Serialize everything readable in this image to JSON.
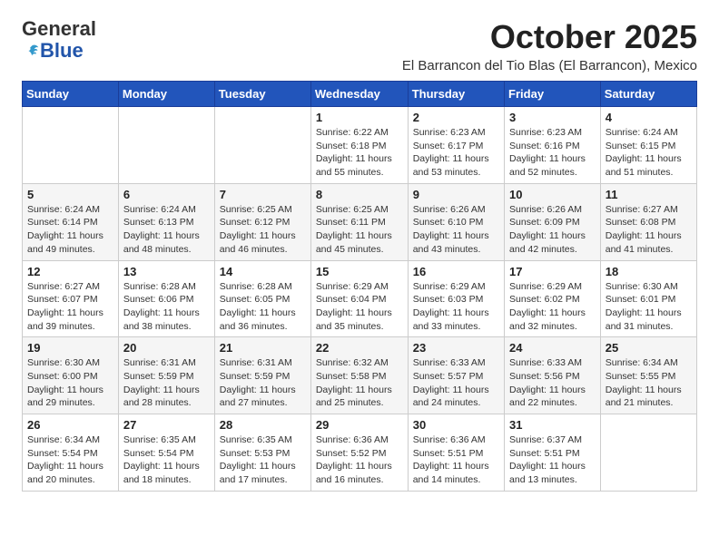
{
  "logo": {
    "general": "General",
    "blue": "Blue"
  },
  "title": "October 2025",
  "subtitle": "El Barrancon del Tio Blas (El Barrancon), Mexico",
  "days_of_week": [
    "Sunday",
    "Monday",
    "Tuesday",
    "Wednesday",
    "Thursday",
    "Friday",
    "Saturday"
  ],
  "weeks": [
    [
      {
        "day": "",
        "info": ""
      },
      {
        "day": "",
        "info": ""
      },
      {
        "day": "",
        "info": ""
      },
      {
        "day": "1",
        "info": "Sunrise: 6:22 AM\nSunset: 6:18 PM\nDaylight: 11 hours\nand 55 minutes."
      },
      {
        "day": "2",
        "info": "Sunrise: 6:23 AM\nSunset: 6:17 PM\nDaylight: 11 hours\nand 53 minutes."
      },
      {
        "day": "3",
        "info": "Sunrise: 6:23 AM\nSunset: 6:16 PM\nDaylight: 11 hours\nand 52 minutes."
      },
      {
        "day": "4",
        "info": "Sunrise: 6:24 AM\nSunset: 6:15 PM\nDaylight: 11 hours\nand 51 minutes."
      }
    ],
    [
      {
        "day": "5",
        "info": "Sunrise: 6:24 AM\nSunset: 6:14 PM\nDaylight: 11 hours\nand 49 minutes."
      },
      {
        "day": "6",
        "info": "Sunrise: 6:24 AM\nSunset: 6:13 PM\nDaylight: 11 hours\nand 48 minutes."
      },
      {
        "day": "7",
        "info": "Sunrise: 6:25 AM\nSunset: 6:12 PM\nDaylight: 11 hours\nand 46 minutes."
      },
      {
        "day": "8",
        "info": "Sunrise: 6:25 AM\nSunset: 6:11 PM\nDaylight: 11 hours\nand 45 minutes."
      },
      {
        "day": "9",
        "info": "Sunrise: 6:26 AM\nSunset: 6:10 PM\nDaylight: 11 hours\nand 43 minutes."
      },
      {
        "day": "10",
        "info": "Sunrise: 6:26 AM\nSunset: 6:09 PM\nDaylight: 11 hours\nand 42 minutes."
      },
      {
        "day": "11",
        "info": "Sunrise: 6:27 AM\nSunset: 6:08 PM\nDaylight: 11 hours\nand 41 minutes."
      }
    ],
    [
      {
        "day": "12",
        "info": "Sunrise: 6:27 AM\nSunset: 6:07 PM\nDaylight: 11 hours\nand 39 minutes."
      },
      {
        "day": "13",
        "info": "Sunrise: 6:28 AM\nSunset: 6:06 PM\nDaylight: 11 hours\nand 38 minutes."
      },
      {
        "day": "14",
        "info": "Sunrise: 6:28 AM\nSunset: 6:05 PM\nDaylight: 11 hours\nand 36 minutes."
      },
      {
        "day": "15",
        "info": "Sunrise: 6:29 AM\nSunset: 6:04 PM\nDaylight: 11 hours\nand 35 minutes."
      },
      {
        "day": "16",
        "info": "Sunrise: 6:29 AM\nSunset: 6:03 PM\nDaylight: 11 hours\nand 33 minutes."
      },
      {
        "day": "17",
        "info": "Sunrise: 6:29 AM\nSunset: 6:02 PM\nDaylight: 11 hours\nand 32 minutes."
      },
      {
        "day": "18",
        "info": "Sunrise: 6:30 AM\nSunset: 6:01 PM\nDaylight: 11 hours\nand 31 minutes."
      }
    ],
    [
      {
        "day": "19",
        "info": "Sunrise: 6:30 AM\nSunset: 6:00 PM\nDaylight: 11 hours\nand 29 minutes."
      },
      {
        "day": "20",
        "info": "Sunrise: 6:31 AM\nSunset: 5:59 PM\nDaylight: 11 hours\nand 28 minutes."
      },
      {
        "day": "21",
        "info": "Sunrise: 6:31 AM\nSunset: 5:59 PM\nDaylight: 11 hours\nand 27 minutes."
      },
      {
        "day": "22",
        "info": "Sunrise: 6:32 AM\nSunset: 5:58 PM\nDaylight: 11 hours\nand 25 minutes."
      },
      {
        "day": "23",
        "info": "Sunrise: 6:33 AM\nSunset: 5:57 PM\nDaylight: 11 hours\nand 24 minutes."
      },
      {
        "day": "24",
        "info": "Sunrise: 6:33 AM\nSunset: 5:56 PM\nDaylight: 11 hours\nand 22 minutes."
      },
      {
        "day": "25",
        "info": "Sunrise: 6:34 AM\nSunset: 5:55 PM\nDaylight: 11 hours\nand 21 minutes."
      }
    ],
    [
      {
        "day": "26",
        "info": "Sunrise: 6:34 AM\nSunset: 5:54 PM\nDaylight: 11 hours\nand 20 minutes."
      },
      {
        "day": "27",
        "info": "Sunrise: 6:35 AM\nSunset: 5:54 PM\nDaylight: 11 hours\nand 18 minutes."
      },
      {
        "day": "28",
        "info": "Sunrise: 6:35 AM\nSunset: 5:53 PM\nDaylight: 11 hours\nand 17 minutes."
      },
      {
        "day": "29",
        "info": "Sunrise: 6:36 AM\nSunset: 5:52 PM\nDaylight: 11 hours\nand 16 minutes."
      },
      {
        "day": "30",
        "info": "Sunrise: 6:36 AM\nSunset: 5:51 PM\nDaylight: 11 hours\nand 14 minutes."
      },
      {
        "day": "31",
        "info": "Sunrise: 6:37 AM\nSunset: 5:51 PM\nDaylight: 11 hours\nand 13 minutes."
      },
      {
        "day": "",
        "info": ""
      }
    ]
  ]
}
